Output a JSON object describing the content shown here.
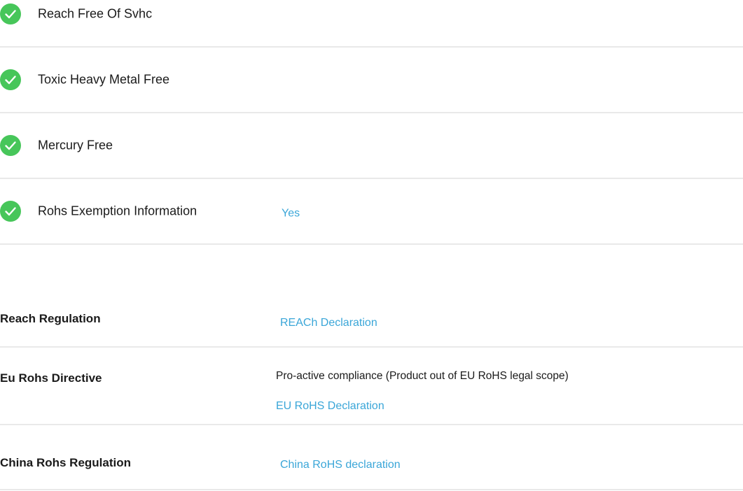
{
  "compliance_checks": [
    {
      "label": "Reach Free Of Svhc",
      "value": ""
    },
    {
      "label": "Toxic Heavy Metal Free",
      "value": ""
    },
    {
      "label": "Mercury Free",
      "value": ""
    },
    {
      "label": "Rohs Exemption Information",
      "value": "Yes"
    }
  ],
  "regulations": {
    "reach": {
      "label": "Reach Regulation",
      "link": "REACh Declaration"
    },
    "eu_rohs": {
      "label": "Eu Rohs Directive",
      "text": "Pro-active compliance (Product out of EU RoHS legal scope)",
      "link": "EU RoHS Declaration"
    },
    "china_rohs": {
      "label": "China Rohs Regulation",
      "link": "China RoHS declaration"
    }
  },
  "colors": {
    "check_green": "#47c65a",
    "link_blue": "#3aa6d8",
    "divider": "#e9e9e9"
  },
  "icons": {
    "check": "check-circle-icon"
  }
}
